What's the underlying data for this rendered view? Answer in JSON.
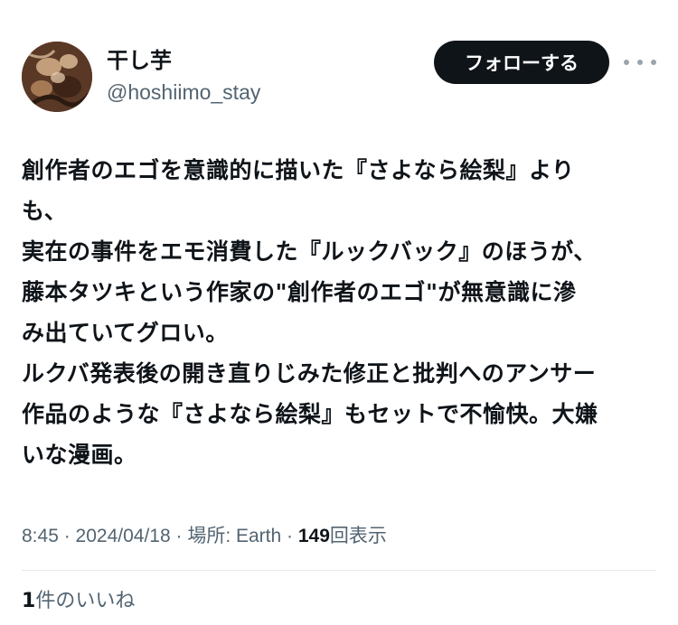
{
  "author": {
    "display_name": "干し芋",
    "handle": "@hoshiimo_stay",
    "avatar_icon": "user-avatar"
  },
  "actions": {
    "follow_label": "フォローする",
    "more_icon": "more-horizontal-icon"
  },
  "tweet": {
    "lines": [
      "創作者のエゴを意識的に描いた『さよなら絵梨』より",
      "も、",
      "実在の事件をエモ消費した『ルックバック』のほうが、",
      "藤本タツキという作家の\"創作者のエゴ\"が無意識に滲",
      "み出ていてグロい。",
      "ルクバ発表後の開き直りじみた修正と批判へのアンサー",
      "作品のような『さよなら絵梨』もセットで不愉快。大嫌",
      "いな漫画。"
    ]
  },
  "meta": {
    "time": "8:45",
    "separator": " · ",
    "date": "2024/04/18",
    "location": "場所: Earth",
    "views_count": "149",
    "views_label": "回表示"
  },
  "engagement": {
    "likes_count": "1",
    "likes_label": "件のいいね"
  },
  "colors": {
    "text": "#0f1419",
    "secondary": "#536471",
    "button_bg": "#0f1419",
    "button_text": "#ffffff",
    "divider": "#e6e9eb"
  }
}
